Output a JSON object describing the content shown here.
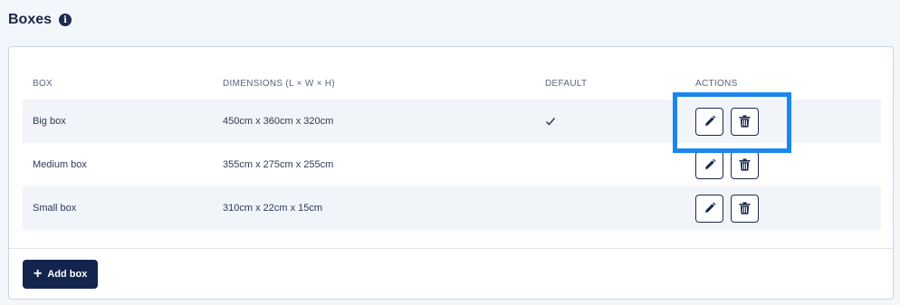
{
  "section": {
    "title": "Boxes",
    "info_icon": "info-icon"
  },
  "table": {
    "headers": {
      "box": "BOX",
      "dimensions": "DIMENSIONS (L × W × H)",
      "default": "DEFAULT",
      "actions": "ACTIONS"
    },
    "rows": [
      {
        "box": "Big box",
        "dimensions": "450cm x 360cm x 320cm",
        "default": true
      },
      {
        "box": "Medium box",
        "dimensions": "355cm x 275cm x 255cm",
        "default": false
      },
      {
        "box": "Small box",
        "dimensions": "310cm x 22cm x 15cm",
        "default": false
      }
    ]
  },
  "add_button": {
    "label": "Add box",
    "icon": "plus-icon"
  },
  "colors": {
    "primary": "#13254d",
    "highlight": "#1a86f0",
    "row_shade": "#f1f4f9"
  }
}
